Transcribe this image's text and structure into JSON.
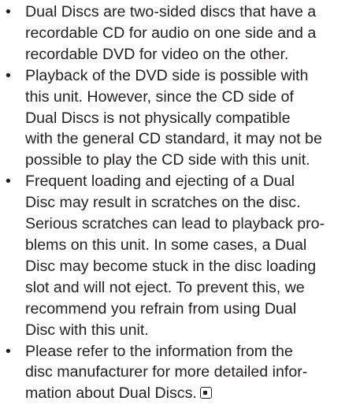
{
  "bullet_symbol": "•",
  "items": [
    {
      "lines": [
        "Dual Discs are two-sided discs that have a",
        "recordable CD for audio on one side and a",
        "recordable DVD for video on the other."
      ]
    },
    {
      "lines": [
        "Playback of the DVD side is possible with",
        "this unit. However, since the CD side of",
        "Dual Discs is not physically compatible",
        "with the general CD standard, it may not be",
        "possible to play the CD side with this unit."
      ]
    },
    {
      "lines": [
        "Frequent loading and ejecting of a Dual",
        "Disc may result in scratches on the disc.",
        "Serious scratches can lead to playback pro-",
        "blems on this unit. In some cases, a Dual",
        "Disc may become stuck in the disc loading",
        "slot and will not eject. To prevent this, we",
        "recommend you refrain from using Dual",
        "Disc with this unit."
      ]
    },
    {
      "lines": [
        "Please refer to the information from the",
        "disc manufacturer for more detailed infor-",
        "mation about Dual Discs."
      ]
    }
  ],
  "end_mark_icon": "end-of-section-icon"
}
